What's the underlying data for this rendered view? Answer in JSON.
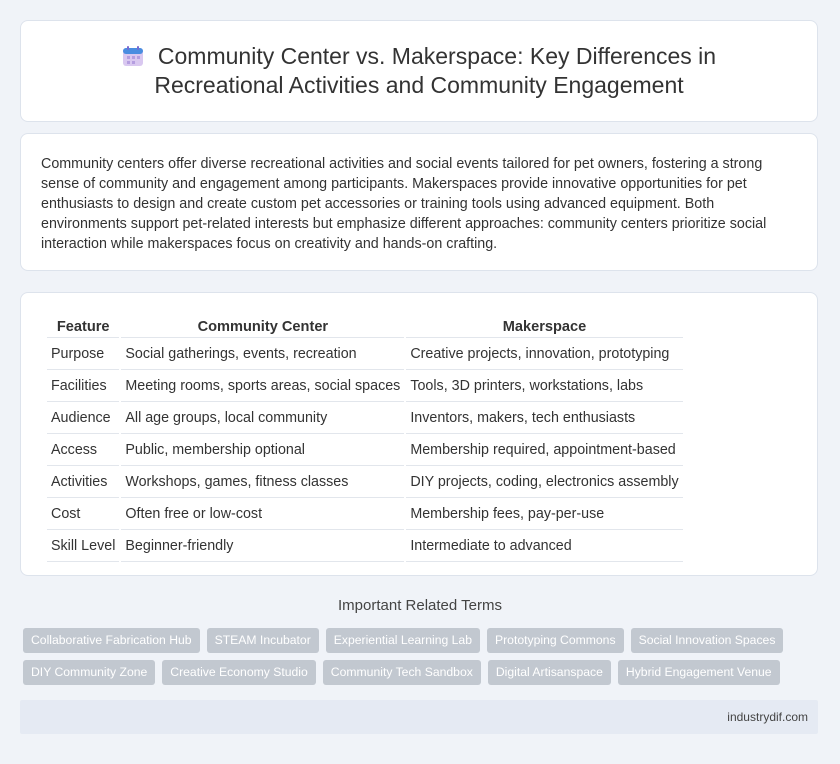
{
  "header": {
    "title": "Community Center vs. Makerspace: Key Differences in Recreational Activities and Community Engagement",
    "icon": "calendar-icon"
  },
  "intro": {
    "text": "Community centers offer diverse recreational activities and social events tailored for pet owners, fostering a strong sense of community and engagement among participants. Makerspaces provide innovative opportunities for pet enthusiasts to design and create custom pet accessories or training tools using advanced equipment. Both environments support pet-related interests but emphasize different approaches: community centers prioritize social interaction while makerspaces focus on creativity and hands-on crafting."
  },
  "table": {
    "headers": [
      "Feature",
      "Community Center",
      "Makerspace"
    ],
    "rows": [
      [
        "Purpose",
        "Social gatherings, events, recreation",
        "Creative projects, innovation, prototyping"
      ],
      [
        "Facilities",
        "Meeting rooms, sports areas, social spaces",
        "Tools, 3D printers, workstations, labs"
      ],
      [
        "Audience",
        "All age groups, local community",
        "Inventors, makers, tech enthusiasts"
      ],
      [
        "Access",
        "Public, membership optional",
        "Membership required, appointment-based"
      ],
      [
        "Activities",
        "Workshops, games, fitness classes",
        "DIY projects, coding, electronics assembly"
      ],
      [
        "Cost",
        "Often free or low-cost",
        "Membership fees, pay-per-use"
      ],
      [
        "Skill Level",
        "Beginner-friendly",
        "Intermediate to advanced"
      ]
    ]
  },
  "related": {
    "title": "Important Related Terms",
    "rows": [
      [
        "Collaborative Fabrication Hub",
        "STEAM Incubator",
        "Experiential Learning Lab",
        "Prototyping Commons",
        "Social Innovation Spaces"
      ],
      [
        "DIY Community Zone",
        "Creative Economy Studio",
        "Community Tech Sandbox",
        "Digital Artisanspace",
        "Hybrid Engagement Venue"
      ]
    ]
  },
  "footer": {
    "site": "industrydif.com"
  },
  "colors": {
    "background": "#f0f3f8",
    "card": "#ffffff",
    "tag": "#c2c8d0",
    "footer": "#e5eaf3"
  }
}
